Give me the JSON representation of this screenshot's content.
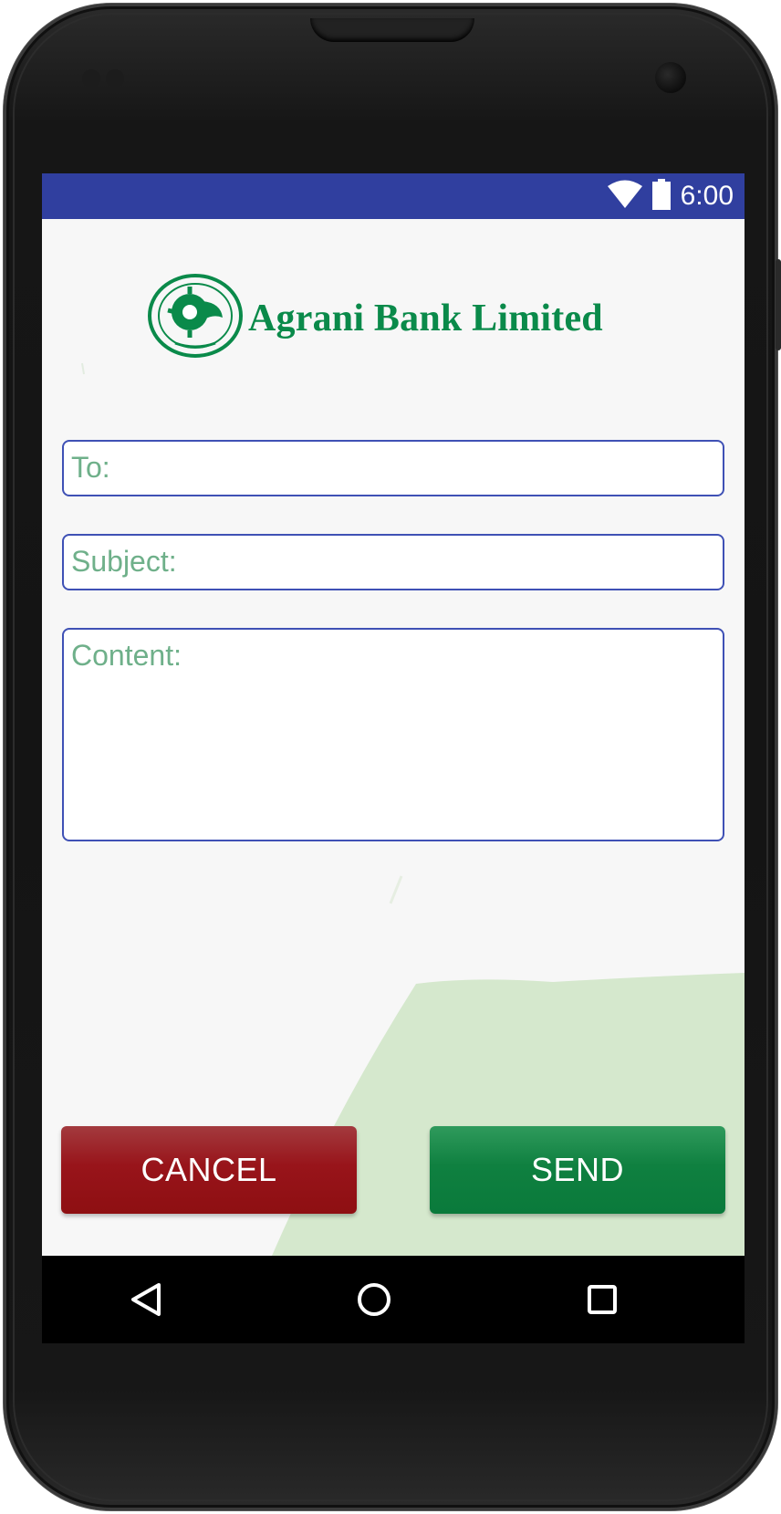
{
  "status_bar": {
    "time": "6:00",
    "wifi_icon": "wifi-icon",
    "battery_icon": "battery-icon",
    "color": "#303f9f"
  },
  "header": {
    "logo_icon": "agrani-bank-emblem-icon",
    "bank_name": "Agrani Bank Limited",
    "brand_color": "#0a8a4a"
  },
  "form": {
    "to_placeholder": "To:",
    "to_value": "",
    "subject_placeholder": "Subject:",
    "subject_value": "",
    "content_placeholder": "Content:",
    "content_value": "",
    "border_color": "#3f51b5",
    "hint_color": "#6fb08a"
  },
  "actions": {
    "cancel_label": "CANCEL",
    "send_label": "SEND",
    "cancel_color": "#98141a",
    "send_color": "#0f8040"
  },
  "nav_bar": {
    "back_icon": "back-triangle-icon",
    "home_icon": "home-circle-icon",
    "recents_icon": "recents-square-icon"
  }
}
